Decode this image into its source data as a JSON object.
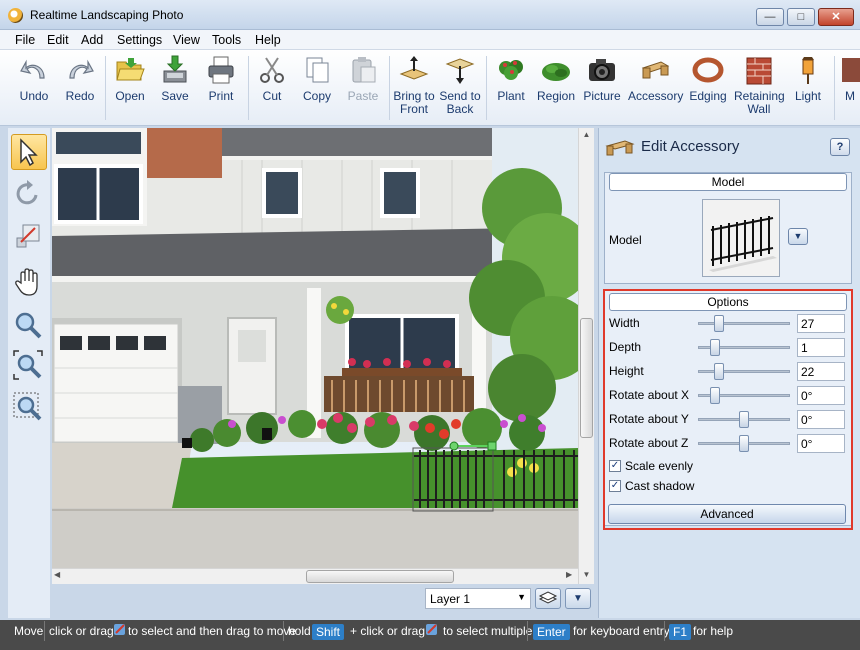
{
  "window": {
    "title": "Realtime Landscaping Photo"
  },
  "menu": [
    "File",
    "Edit",
    "Add",
    "Settings",
    "View",
    "Tools",
    "Help"
  ],
  "toolbar": {
    "undo": "Undo",
    "redo": "Redo",
    "open": "Open",
    "save": "Save",
    "print": "Print",
    "cut": "Cut",
    "copy": "Copy",
    "paste": "Paste",
    "bring_to_front_1": "Bring to",
    "bring_to_front_2": "Front",
    "send_to_back_1": "Send to",
    "send_to_back_2": "Back",
    "plant": "Plant",
    "region": "Region",
    "picture": "Picture",
    "accessory": "Accessory",
    "edging": "Edging",
    "retaining_wall_1": "Retaining",
    "retaining_wall_2": "Wall",
    "light": "Light",
    "more": "M"
  },
  "layer": {
    "selected": "Layer 1"
  },
  "panel": {
    "title": "Edit Accessory",
    "help": "?",
    "model_group": "Model",
    "model_label": "Model",
    "options_group": "Options",
    "options": [
      {
        "label": "Width",
        "value": "27",
        "slider": 0.2
      },
      {
        "label": "Depth",
        "value": "1",
        "slider": 0.15
      },
      {
        "label": "Height",
        "value": "22",
        "slider": 0.2
      },
      {
        "label": "Rotate about X",
        "value": "0°",
        "slider": 0.15
      },
      {
        "label": "Rotate about Y",
        "value": "0°",
        "slider": 0.5
      },
      {
        "label": "Rotate about Z",
        "value": "0°",
        "slider": 0.5
      }
    ],
    "scale_evenly": "Scale evenly",
    "scale_evenly_checked": true,
    "cast_shadow": "Cast shadow",
    "cast_shadow_checked": true,
    "advanced": "Advanced"
  },
  "status": {
    "mode": "Move",
    "t1": "click or drag",
    "t2": "to select and then drag to move",
    "t3": "hold",
    "shift": "Shift",
    "t4": "+ click or drag",
    "t5": "to select multiple",
    "enter": "Enter",
    "t6": "for keyboard entry",
    "f1": "F1",
    "t7": "for help"
  },
  "colors": {
    "accent_red": "#e0392b",
    "status_key": "#2d7fc8"
  }
}
